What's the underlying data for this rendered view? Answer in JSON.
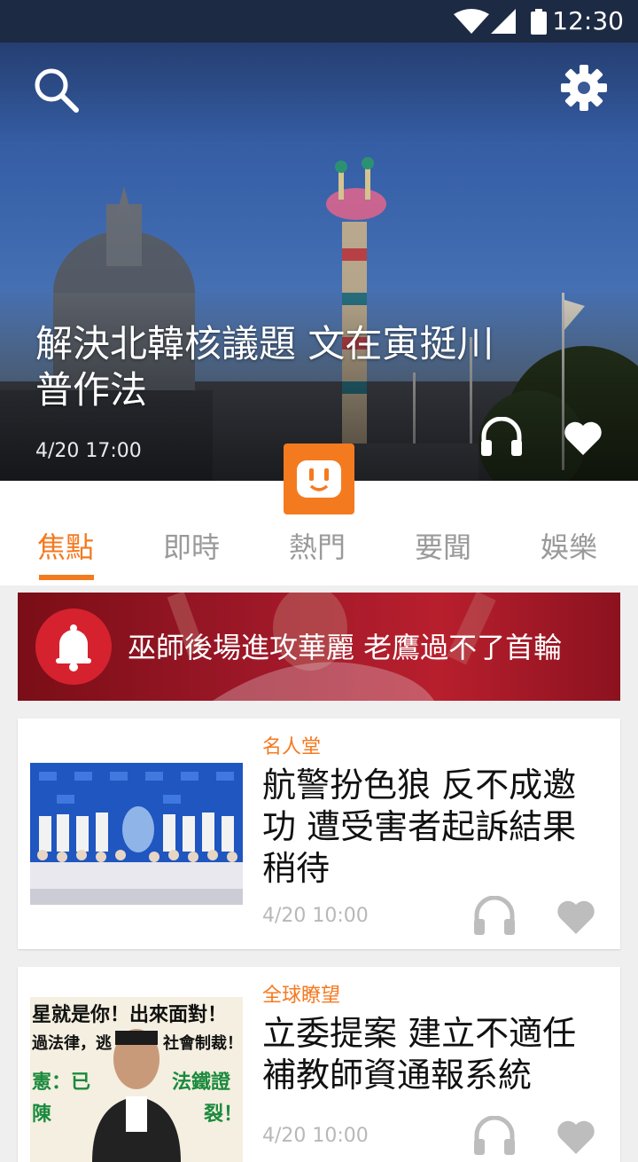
{
  "status_bar": {
    "time": "12:30"
  },
  "hero": {
    "title": "解決北韓核議題 文在寅挺川普作法",
    "date": "4/20 17:00"
  },
  "tabs": [
    {
      "label": "焦點",
      "active": true
    },
    {
      "label": "即時",
      "active": false
    },
    {
      "label": "熱門",
      "active": false
    },
    {
      "label": "要聞",
      "active": false
    },
    {
      "label": "娛樂",
      "active": false
    }
  ],
  "breaking": {
    "text": "巫師後場進攻華麗 老鷹過不了首輪"
  },
  "articles": [
    {
      "category": "名人堂",
      "title": "航警扮色狼 反不成邀功 遭受害者起訴結果稍待",
      "date": "4/20 10:00"
    },
    {
      "category": "全球瞭望",
      "title": "立委提案 建立不適任補教師資通報系統",
      "date": "4/20 10:00"
    }
  ],
  "poster_text": {
    "line1": "星就是你！出來面對！",
    "line2": "過法律，逃",
    "line3": "社會制裁！",
    "line4": "憲：已",
    "line5": "法鐵證",
    "line6": "陳",
    "line7": "裂！"
  },
  "colors": {
    "accent": "#f47a20",
    "banner_red": "#d6222e"
  },
  "icons": {
    "search": "search-icon",
    "settings": "gear-icon",
    "listen": "headphones-icon",
    "like": "heart-icon",
    "alert": "bell-icon"
  }
}
